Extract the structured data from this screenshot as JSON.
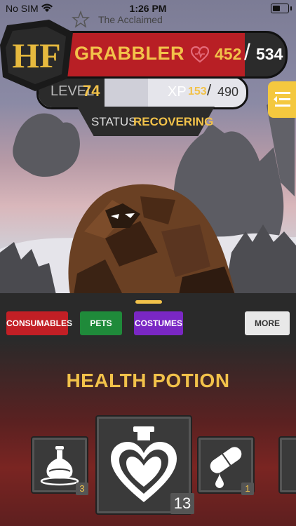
{
  "status_bar": {
    "carrier": "No SIM",
    "time": "1:26 PM"
  },
  "hud": {
    "subtitle": "The Acclaimed",
    "emblem_text": "HF",
    "name": "GRABBLER",
    "hp": "452",
    "hp_slash": "/",
    "hp_max": "534",
    "level_label": "LEVEL",
    "level": "74",
    "xp_label": "XP",
    "xp": "153",
    "xp_slash": "/",
    "xp_max": "490",
    "xp_progress": 0.31,
    "status_label": "STATUS",
    "status": "RECOVERING"
  },
  "categories": [
    {
      "label": "CONSUMABLES",
      "color": "#c21f25"
    },
    {
      "label": "PETS",
      "color": "#1f8a3a"
    },
    {
      "label": "COSTUMES",
      "color": "#7a27c4"
    },
    {
      "label": "MORE",
      "color": "#e8e8e8"
    }
  ],
  "selected_item": {
    "title": "HEALTH POTION",
    "slots": [
      {
        "icon": "flask-icon",
        "count": "3"
      },
      {
        "icon": "heart-potion-icon",
        "count": "13"
      },
      {
        "icon": "pill-icon",
        "count": "1"
      }
    ]
  },
  "colors": {
    "accent": "#f2c24a",
    "hp_bar": "#b81f25",
    "menu_button": "#f4c83f"
  }
}
